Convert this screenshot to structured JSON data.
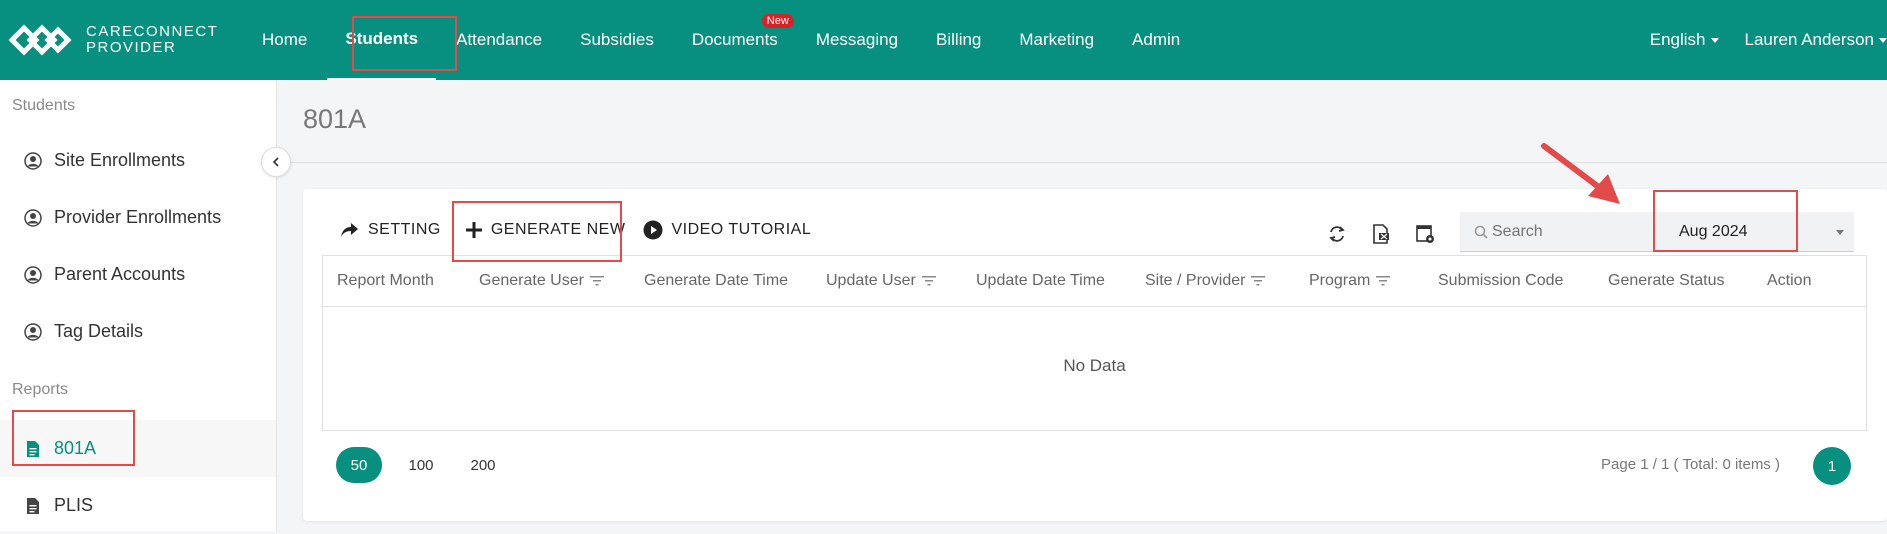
{
  "brand": {
    "line1": "CARECONNECT",
    "line2": "PROVIDER"
  },
  "nav": {
    "items": [
      {
        "label": "Home"
      },
      {
        "label": "Students"
      },
      {
        "label": "Attendance"
      },
      {
        "label": "Subsidies"
      },
      {
        "label": "Documents",
        "badge": "New"
      },
      {
        "label": "Messaging"
      },
      {
        "label": "Billing"
      },
      {
        "label": "Marketing"
      },
      {
        "label": "Admin"
      }
    ],
    "language": "English",
    "user": "Lauren Anderson"
  },
  "sidebar": {
    "students_section": "Students",
    "students_items": [
      "Site Enrollments",
      "Provider Enrollments",
      "Parent Accounts",
      "Tag Details"
    ],
    "reports_section": "Reports",
    "reports_items": [
      "801A",
      "PLIS"
    ]
  },
  "page": {
    "title": "801A"
  },
  "toolbar": {
    "setting": "SETTING",
    "generate_new": "GENERATE NEW",
    "video_tutorial": "VIDEO TUTORIAL"
  },
  "search": {
    "placeholder": "Search"
  },
  "month_select": {
    "value": "Aug 2024"
  },
  "table": {
    "columns": [
      "Report Month",
      "Generate User",
      "Generate Date Time",
      "Update User",
      "Update Date Time",
      "Site / Provider",
      "Program",
      "Submission Code",
      "Generate Status",
      "Action"
    ],
    "empty_text": "No Data"
  },
  "pagination": {
    "sizes": [
      "50",
      "100",
      "200"
    ],
    "info": "Page 1 / 1 ( Total: 0 items )",
    "current_page": "1"
  },
  "colors": {
    "brand": "#078f7f",
    "annotation": "#e34a4a",
    "badge": "#d6232a"
  }
}
